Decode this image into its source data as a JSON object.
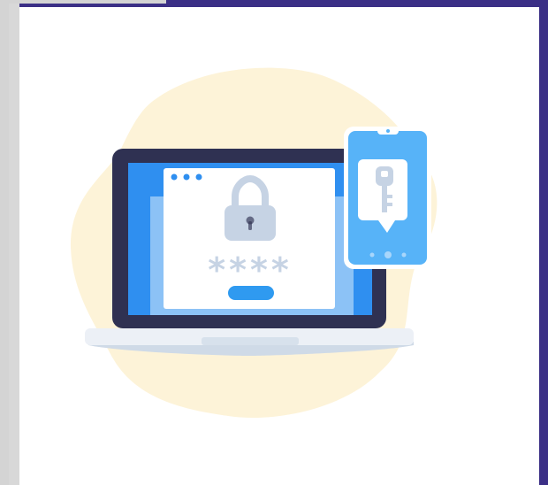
{
  "illustration": {
    "subject": "two-factor-authentication",
    "password_mask": "****",
    "icons": [
      "padlock-icon",
      "key-icon",
      "laptop-icon",
      "smartphone-icon",
      "speech-bubble-icon"
    ],
    "colors": {
      "frame_purple": "#3b2f86",
      "frame_gray": "#d2d2d2",
      "background": "#ffffff",
      "blob": "#fdf3d8",
      "laptop_body": "#2f3152",
      "screen_blue": "#2f8ff0",
      "panel_light_blue": "#8cc2f6",
      "window_white": "#ffffff",
      "window_dots": "#2f8ff0",
      "lock_gray": "#c6d3e4",
      "asterisks": "#c6d3e4",
      "login_button": "#2f9af0",
      "laptop_base": "#ecf0f6",
      "laptop_base_shadow": "#cfdae7",
      "phone_blue": "#57b3f8",
      "phone_border": "#ffffff",
      "phone_dots": "#a8d6fb",
      "key_gray": "#c6d3e4"
    }
  }
}
